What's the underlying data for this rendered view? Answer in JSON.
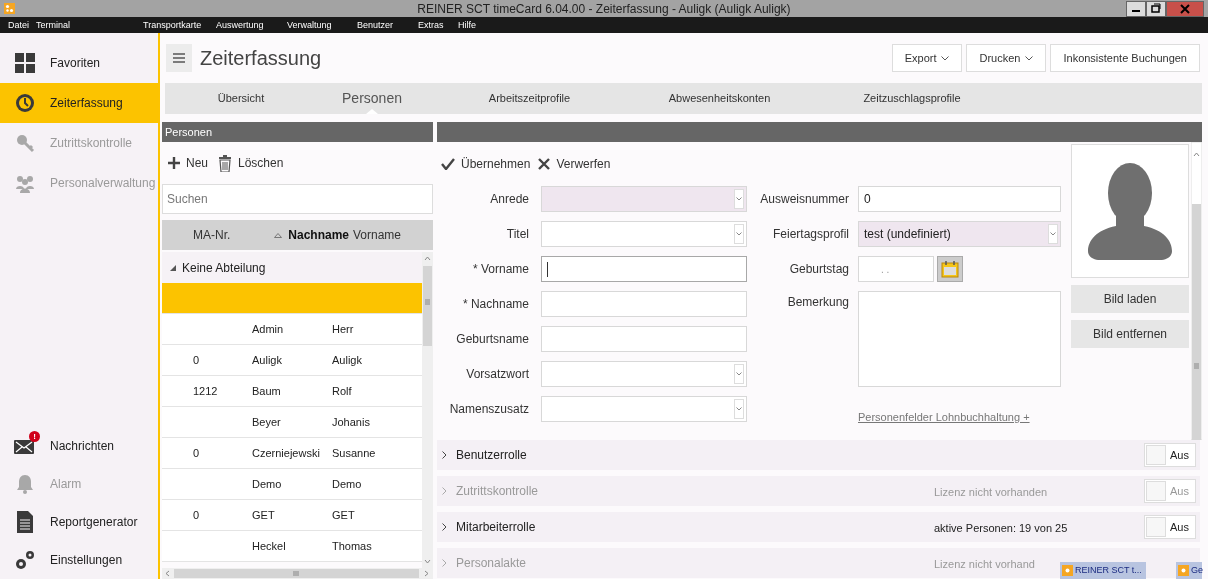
{
  "window": {
    "title": "REINER SCT timeCard 6.04.00 - Zeiterfassung - Auligk (Auligk Auligk)"
  },
  "menu": [
    "Datei",
    "Terminal",
    "Transportkarte",
    "Auswertung",
    "Verwaltung",
    "Benutzer",
    "Extras",
    "Hilfe"
  ],
  "sidebar": {
    "top_items": [
      {
        "label": "Favoriten",
        "selected": false,
        "disabled": false
      },
      {
        "label": "Zeiterfassung",
        "selected": true,
        "disabled": false
      },
      {
        "label": "Zutrittskontrolle",
        "selected": false,
        "disabled": true
      },
      {
        "label": "Personalverwaltung",
        "selected": false,
        "disabled": true
      }
    ],
    "bottom_items": [
      {
        "label": "Nachrichten",
        "badge": "!",
        "selected": false,
        "disabled": false
      },
      {
        "label": "Alarm",
        "selected": false,
        "disabled": true
      },
      {
        "label": "Reportgenerator",
        "selected": false,
        "disabled": false
      },
      {
        "label": "Einstellungen",
        "selected": false,
        "disabled": false
      }
    ]
  },
  "header": {
    "title": "Zeiterfassung",
    "buttons": [
      {
        "label": "Export",
        "dropdown": true
      },
      {
        "label": "Drucken",
        "dropdown": true
      },
      {
        "label": "Inkonsistente Buchungen",
        "dropdown": false
      }
    ]
  },
  "tabs": [
    {
      "label": "Übersicht",
      "selected": false
    },
    {
      "label": "Personen",
      "selected": true
    },
    {
      "label": "Arbeitszeitprofile",
      "selected": false
    },
    {
      "label": "Abwesenheitskonten",
      "selected": false
    },
    {
      "label": "Zeitzuschlagsprofile",
      "selected": false
    }
  ],
  "persons_panel": {
    "title": "Personen",
    "actions": [
      {
        "label": "Neu"
      },
      {
        "label": "Löschen"
      }
    ],
    "search": {
      "placeholder": "Suchen"
    },
    "columns": [
      {
        "label": "MA-Nr.",
        "sorted": false
      },
      {
        "label": "Nachname",
        "sorted": true
      },
      {
        "label": "Vorname",
        "sorted": false
      }
    ],
    "group": {
      "label": "Keine Abteilung",
      "expanded": true
    },
    "rows": [
      {
        "selected": true
      },
      {
        "nachname": "Admin",
        "vorname": "Herr",
        "selected": false
      },
      {
        "ma_nr": "0",
        "nachname": "Auligk",
        "vorname": "Auligk",
        "selected": false
      },
      {
        "ma_nr": "1212",
        "nachname": "Baum",
        "vorname": "Rolf",
        "selected": false
      },
      {
        "nachname": "Beyer",
        "vorname": "Johanis",
        "selected": false
      },
      {
        "ma_nr": "0",
        "nachname": "Czerniejewski",
        "vorname": "Susanne",
        "selected": false
      },
      {
        "nachname": "Demo",
        "vorname": "Demo",
        "selected": false
      },
      {
        "ma_nr": "0",
        "nachname": "GET",
        "vorname": "GET",
        "selected": false
      },
      {
        "nachname": "Heckel",
        "vorname": "Thomas",
        "selected": false
      }
    ]
  },
  "form": {
    "actions": [
      {
        "label": "Übernehmen"
      },
      {
        "label": "Verwerfen"
      }
    ],
    "left_fields": [
      {
        "label": "Anrede",
        "kind": "select",
        "shaded": true
      },
      {
        "label": "Titel",
        "kind": "select",
        "shaded": false
      },
      {
        "label": "* Vorname",
        "kind": "text",
        "shaded": false,
        "focused": true
      },
      {
        "label": "* Nachname",
        "kind": "text",
        "shaded": false,
        "focused": false
      },
      {
        "label": "Geburtsname",
        "kind": "text",
        "shaded": false,
        "focused": false
      },
      {
        "label": "Vorsatzwort",
        "kind": "select",
        "shaded": false
      },
      {
        "label": "Namenszusatz",
        "kind": "select",
        "shaded": false
      }
    ],
    "right_fields": [
      {
        "label": "Ausweisnummer",
        "kind": "text",
        "value": "0",
        "shaded": false
      },
      {
        "label": "Feiertagsprofil",
        "kind": "select",
        "value": "test (undefiniert)",
        "shaded": true
      },
      {
        "label": "Geburtstag",
        "kind": "date",
        "placeholder": ". ."
      },
      {
        "label": "Bemerkung",
        "kind": "textarea"
      }
    ],
    "link": "Personenfelder Lohnbuchhaltung +",
    "photo_buttons": [
      "Bild laden",
      "Bild entfernen"
    ]
  },
  "sections": [
    {
      "label": "Benutzerrolle",
      "disabled": false,
      "on": false,
      "toggle_label": "Aus"
    },
    {
      "label": "Zutrittskontrolle",
      "status": "Lizenz nicht vorhanden",
      "disabled": true,
      "on": false,
      "toggle_label": "Aus"
    },
    {
      "label": "Mitarbeiterrolle",
      "status": "aktive Personen: 19 von 25",
      "disabled": false,
      "on": false,
      "toggle_label": "Aus"
    },
    {
      "label": "Personalakte",
      "status": "Lizenz nicht vorhand",
      "disabled": true
    }
  ],
  "taskbar_overlay": [
    {
      "label": "REINER SCT t..."
    },
    {
      "label": "Ge"
    }
  ]
}
